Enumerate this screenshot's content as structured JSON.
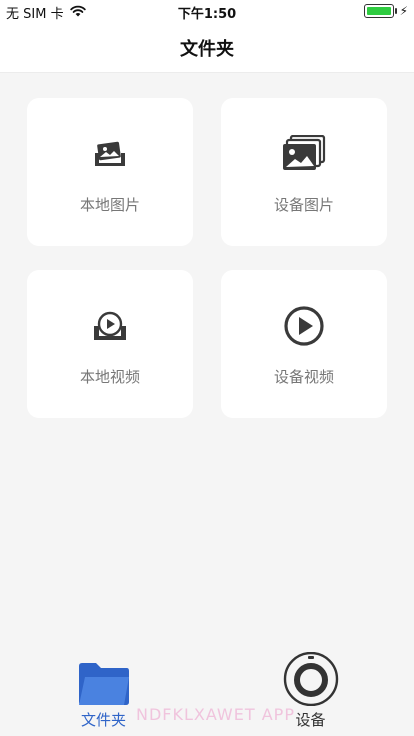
{
  "status_bar": {
    "carrier": "无 SIM 卡",
    "time": "下午1:50"
  },
  "nav": {
    "title": "文件夹"
  },
  "cards": [
    {
      "label": "本地图片",
      "icon": "local-pictures-icon"
    },
    {
      "label": "设备图片",
      "icon": "device-pictures-icon"
    },
    {
      "label": "本地视频",
      "icon": "local-video-icon"
    },
    {
      "label": "设备视频",
      "icon": "device-video-icon"
    }
  ],
  "tabbar": {
    "tabs": [
      {
        "label": "文件夹",
        "icon": "folder-icon",
        "active": true
      },
      {
        "label": "设备",
        "icon": "device-camera-icon",
        "active": false
      }
    ]
  },
  "watermark": "NDFKLXAWET APP",
  "colors": {
    "accent": "#2f64c8",
    "background": "#f5f5f5",
    "battery": "#2ecc40"
  }
}
